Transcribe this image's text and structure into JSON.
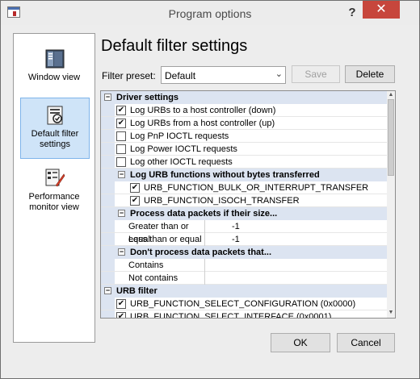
{
  "window": {
    "title": "Program options",
    "help_glyph": "?",
    "close_glyph": "✕"
  },
  "sidebar": {
    "items": [
      {
        "label": "Window view",
        "icon": "window-view-icon",
        "selected": false
      },
      {
        "label": "Default filter settings",
        "icon": "filter-settings-icon",
        "selected": true
      },
      {
        "label": "Performance monitor view",
        "icon": "performance-monitor-icon",
        "selected": false
      }
    ]
  },
  "content": {
    "title": "Default filter settings",
    "preset_label": "Filter preset:",
    "preset_value": "Default",
    "save_label": "Save",
    "delete_label": "Delete"
  },
  "grid": {
    "driver_settings": {
      "title": "Driver settings",
      "items": [
        {
          "label": "Log URBs to a host controller (down)",
          "checked": true
        },
        {
          "label": "Log URBs from a host controller (up)",
          "checked": true
        },
        {
          "label": "Log PnP IOCTL requests",
          "checked": false
        },
        {
          "label": "Log Power IOCTL requests",
          "checked": false
        },
        {
          "label": "Log other IOCTL requests",
          "checked": false
        }
      ]
    },
    "log_urb_without_bytes": {
      "title": "Log URB functions without bytes transferred",
      "items": [
        {
          "label": "URB_FUNCTION_BULK_OR_INTERRUPT_TRANSFER",
          "checked": true
        },
        {
          "label": "URB_FUNCTION_ISOCH_TRANSFER",
          "checked": true
        }
      ]
    },
    "process_size": {
      "title": "Process data packets if their size...",
      "rows": [
        {
          "name": "Greater than or equal",
          "value": "-1"
        },
        {
          "name": "Less than or equal",
          "value": "-1"
        }
      ]
    },
    "dont_process": {
      "title": "Don't process data packets that...",
      "rows": [
        {
          "name": "Contains",
          "value": ""
        },
        {
          "name": "Not contains",
          "value": ""
        }
      ]
    },
    "urb_filter": {
      "title": "URB filter",
      "items": [
        {
          "label": "URB_FUNCTION_SELECT_CONFIGURATION (0x0000)",
          "checked": true
        },
        {
          "label": "URB_FUNCTION_SELECT_INTERFACE (0x0001)",
          "checked": true
        }
      ]
    },
    "collapse_glyph": "−",
    "check_glyph": "✔"
  },
  "footer": {
    "ok_label": "OK",
    "cancel_label": "Cancel"
  },
  "colors": {
    "accent_selected": "#cfe4f8",
    "section_bg": "#dce4f1",
    "close_red": "#c7463c"
  }
}
